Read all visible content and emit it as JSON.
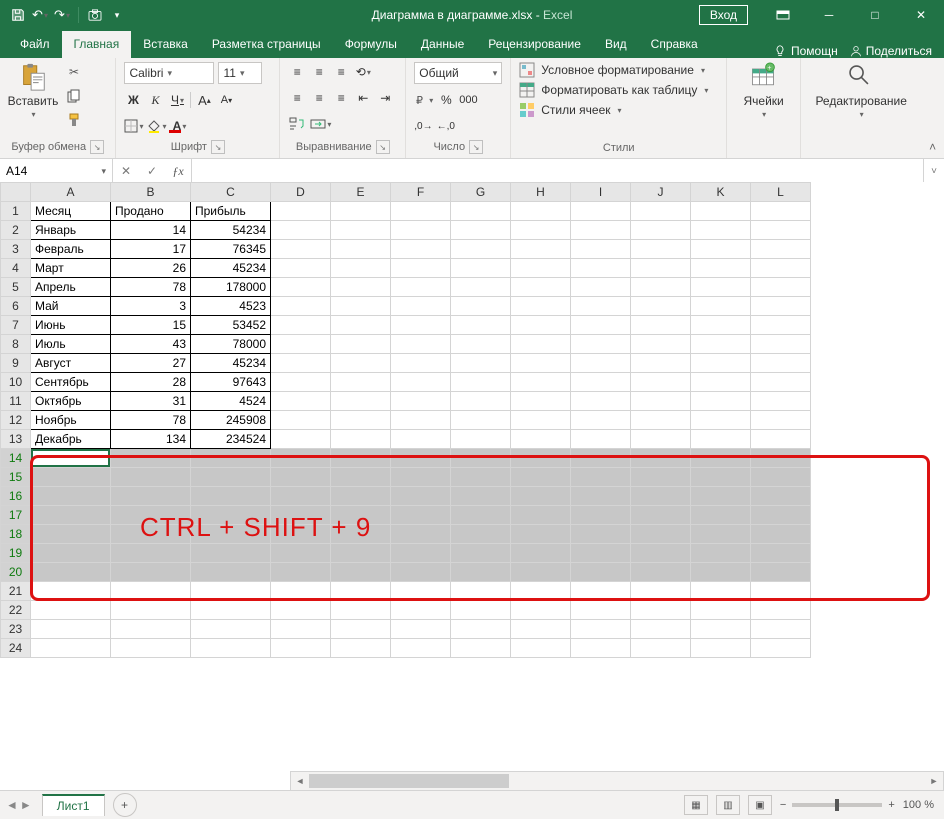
{
  "title": {
    "filename": "Диаграмма в диаграмме.xlsx",
    "sep": "  -  ",
    "app": "Excel"
  },
  "login": "Вход",
  "tabs": [
    "Файл",
    "Главная",
    "Вставка",
    "Разметка страницы",
    "Формулы",
    "Данные",
    "Рецензирование",
    "Вид",
    "Справка"
  ],
  "active_tab_index": 1,
  "tell_me": "Помощн",
  "share": "Поделиться",
  "ribbon": {
    "clipboard": {
      "label": "Буфер обмена",
      "paste": "Вставить"
    },
    "font": {
      "label": "Шрифт",
      "name": "Calibri",
      "size": "11"
    },
    "alignment": {
      "label": "Выравнивание"
    },
    "number": {
      "label": "Число",
      "format": "Общий"
    },
    "styles": {
      "label": "Стили",
      "cond": "Условное форматирование",
      "tbl": "Форматировать как таблицу",
      "cell": "Стили ячеек"
    },
    "cells": {
      "label": "Ячейки"
    },
    "editing": {
      "label": "Редактирование"
    }
  },
  "namebox": "A14",
  "columns": [
    "A",
    "B",
    "C",
    "D",
    "E",
    "F",
    "G",
    "H",
    "I",
    "J",
    "K",
    "L"
  ],
  "data_rows": [
    {
      "r": "1",
      "a": "Месяц",
      "b": "Продано",
      "c": "Прибыль",
      "num": false
    },
    {
      "r": "2",
      "a": "Январь",
      "b": "14",
      "c": "54234",
      "num": true
    },
    {
      "r": "3",
      "a": "Февраль",
      "b": "17",
      "c": "76345",
      "num": true
    },
    {
      "r": "4",
      "a": "Март",
      "b": "26",
      "c": "45234",
      "num": true
    },
    {
      "r": "5",
      "a": "Апрель",
      "b": "78",
      "c": "178000",
      "num": true
    },
    {
      "r": "6",
      "a": "Май",
      "b": "3",
      "c": "4523",
      "num": true
    },
    {
      "r": "7",
      "a": "Июнь",
      "b": "15",
      "c": "53452",
      "num": true
    },
    {
      "r": "8",
      "a": "Июль",
      "b": "43",
      "c": "78000",
      "num": true
    },
    {
      "r": "9",
      "a": "Август",
      "b": "27",
      "c": "45234",
      "num": true
    },
    {
      "r": "10",
      "a": "Сентябрь",
      "b": "28",
      "c": "97643",
      "num": true
    },
    {
      "r": "11",
      "a": "Октябрь",
      "b": "31",
      "c": "4524",
      "num": true
    },
    {
      "r": "12",
      "a": "Ноябрь",
      "b": "78",
      "c": "245908",
      "num": true
    },
    {
      "r": "13",
      "a": "Декабрь",
      "b": "134",
      "c": "234524",
      "num": true
    }
  ],
  "selected_rows": [
    "14",
    "15",
    "16",
    "17",
    "18",
    "19",
    "20"
  ],
  "empty_rows": [
    "21",
    "22",
    "23",
    "24"
  ],
  "overlay_text": "CTRL + SHIFT + 9",
  "sheet": "Лист1",
  "zoom": "100 %"
}
